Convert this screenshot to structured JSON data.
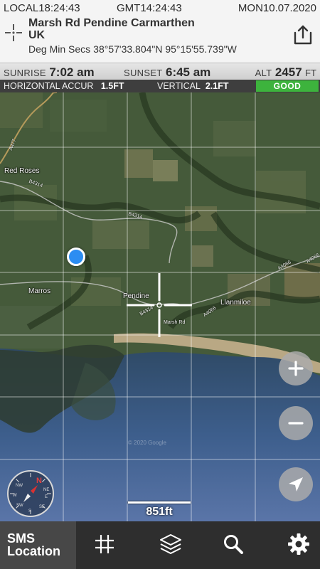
{
  "header": {
    "local_time": "LOCAL18:24:43",
    "gmt_time": "GMT14:24:43",
    "date": "MON10.07.2020",
    "address_line1": "Marsh Rd Pendine Carmarthen",
    "address_line2": "UK",
    "coord_format": "Deg Min Secs",
    "coordinates": "38°57'33.804\"N 95°15'55.739\"W"
  },
  "sun": {
    "sunrise_label": "SUNRISE",
    "sunrise_value": "7:02 am",
    "sunset_label": "SUNSET",
    "sunset_value": "6:45 am",
    "alt_label": "ALT",
    "alt_value": "2457",
    "alt_unit": "FT"
  },
  "accuracy": {
    "horizontal_label": "HORIZONTAL ACCUR",
    "horizontal_value": "1.5FT",
    "vertical_label": "VERTICAL",
    "vertical_value": "2.1FT",
    "status": "GOOD",
    "status_color": "#3db33d"
  },
  "map": {
    "places": {
      "red_roses": "Red Roses",
      "marros": "Marros",
      "pendine": "Pendine",
      "llanmiloe": "Llanmiloe"
    },
    "roads": {
      "a477": "A477",
      "b4314_a": "B4314",
      "b4314_b": "B4314",
      "b4314_c": "B4314",
      "a4066_a": "A4066",
      "a4066_b": "A4066",
      "a4066_c": "A4066",
      "marsh_rd": "Marsh Rd"
    },
    "watermark": "© 2020 Google",
    "location_dot_color": "#2c8df2",
    "scale_text": "851ft",
    "compass_letter": "N",
    "compass_marks": [
      "NE",
      "E",
      "SE",
      "S",
      "SW",
      "W",
      "NW"
    ]
  },
  "toolbar": {
    "sms_label_1": "SMS",
    "sms_label_2": "Location",
    "icons": [
      "grid-icon",
      "layers-icon",
      "search-icon",
      "gear-icon"
    ]
  }
}
